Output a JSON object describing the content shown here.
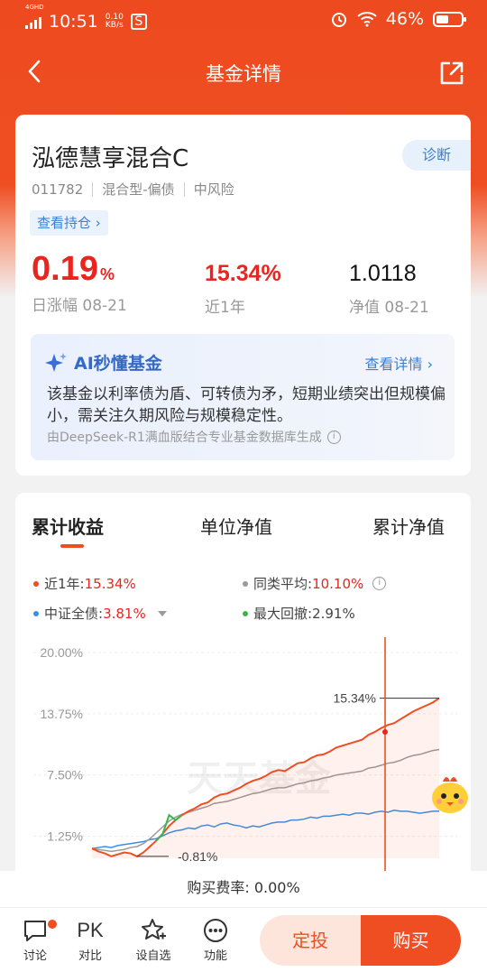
{
  "status": {
    "net": "4GHD",
    "time": "10:51",
    "speed_value": "0.10",
    "speed_unit": "KB/s",
    "battery": "46%"
  },
  "nav": {
    "title": "基金详情"
  },
  "fund": {
    "name": "泓德慧享混合C",
    "diagnose": "诊断",
    "code": "011782",
    "type": "混合型-偏债",
    "risk": "中风险",
    "holdings": "查看持仓 ›",
    "day_change": "0.19",
    "day_change_unit": "%",
    "day_change_label": "日涨幅 08-21",
    "year_return": "15.34%",
    "year_return_label": "近1年",
    "nav_value": "1.0118",
    "nav_label": "净值 08-21"
  },
  "ai": {
    "title": "AI秒懂基金",
    "more": "查看详情 ›",
    "text": "该基金以利率债为盾、可转债为矛，短期业绩突出但规模偏小，需关注久期风险与规模稳定性。",
    "source": "由DeepSeek-R1满血版结合专业基金数据库生成"
  },
  "chart_tabs": [
    "累计收益",
    "单位净值",
    "累计净值"
  ],
  "legend": {
    "fund_label": "近1年:",
    "fund_value": "15.34%",
    "peer_label": "同类平均:",
    "peer_value": "10.10%",
    "index_label": "中证全债:",
    "index_value": "3.81%",
    "dd_label": "最大回撤:",
    "dd_value": "2.91%"
  },
  "chart_data": {
    "type": "line",
    "y_ticks": [
      "20.00%",
      "13.75%",
      "7.50%",
      "1.25%"
    ],
    "ylim": [
      -1,
      20
    ],
    "watermark": "天天基金",
    "annotations": {
      "max": "15.34%",
      "min": "-0.81%"
    },
    "series": [
      {
        "name": "近1年",
        "color": "#ef4e23",
        "values": [
          0,
          -0.3,
          -0.5,
          -0.8,
          -0.6,
          -0.4,
          -0.5,
          -0.81,
          -0.4,
          0.2,
          0.8,
          1.5,
          2.3,
          2.9,
          3.4,
          3.8,
          4.1,
          4.5,
          4.7,
          5.2,
          5.5,
          5.6,
          5.9,
          6.2,
          6.6,
          6.9,
          7.1,
          7.4,
          7.8,
          8.0,
          7.9,
          8.3,
          8.7,
          8.8,
          9.2,
          9.5,
          9.6,
          9.9,
          10.3,
          10.5,
          10.7,
          10.9,
          11.1,
          11.6,
          11.9,
          12.3,
          12.6,
          12.8,
          13.2,
          13.6,
          14.0,
          14.3,
          14.6,
          14.9,
          15.34
        ]
      },
      {
        "name": "同类平均",
        "color": "#9a9a9a",
        "values": [
          0,
          -0.1,
          -0.2,
          -0.3,
          -0.2,
          -0.1,
          0.1,
          0.2,
          0.5,
          1.0,
          1.6,
          2.2,
          2.8,
          3.2,
          3.5,
          3.7,
          3.9,
          4.1,
          4.3,
          4.6,
          4.7,
          4.8,
          5.0,
          5.2,
          5.4,
          5.6,
          5.7,
          5.9,
          6.1,
          6.2,
          6.2,
          6.4,
          6.6,
          6.7,
          6.9,
          7.0,
          7.2,
          7.3,
          7.5,
          7.6,
          7.7,
          7.8,
          7.9,
          8.2,
          8.3,
          8.5,
          8.7,
          8.8,
          9.0,
          9.3,
          9.5,
          9.6,
          9.8,
          10.0,
          10.1
        ]
      },
      {
        "name": "中证全债",
        "color": "#3a8ee6",
        "values": [
          0,
          0.1,
          0.2,
          0.1,
          0.3,
          0.4,
          0.5,
          0.6,
          0.7,
          0.9,
          1.0,
          1.3,
          1.6,
          1.8,
          1.9,
          2.1,
          2.0,
          2.3,
          2.4,
          2.2,
          2.5,
          2.6,
          2.4,
          2.3,
          2.1,
          2.3,
          2.2,
          2.4,
          2.6,
          2.7,
          2.7,
          2.9,
          2.9,
          3.0,
          3.2,
          3.1,
          3.3,
          3.3,
          3.4,
          3.5,
          3.4,
          3.6,
          3.6,
          3.5,
          3.7,
          3.8,
          3.7,
          3.9,
          3.8,
          3.8,
          3.7,
          3.6,
          3.7,
          3.8,
          3.81
        ]
      }
    ]
  },
  "fee": {
    "text": "购买费率: 0.00%"
  },
  "bottom": {
    "discuss": "讨论",
    "pk_icon": "PK",
    "compare": "对比",
    "watch": "设自选",
    "more": "功能",
    "dingtou": "定投",
    "buy": "购买"
  },
  "colors": {
    "primary": "#ef4e23",
    "rise": "#e8251f",
    "link": "#3d7fd0"
  }
}
